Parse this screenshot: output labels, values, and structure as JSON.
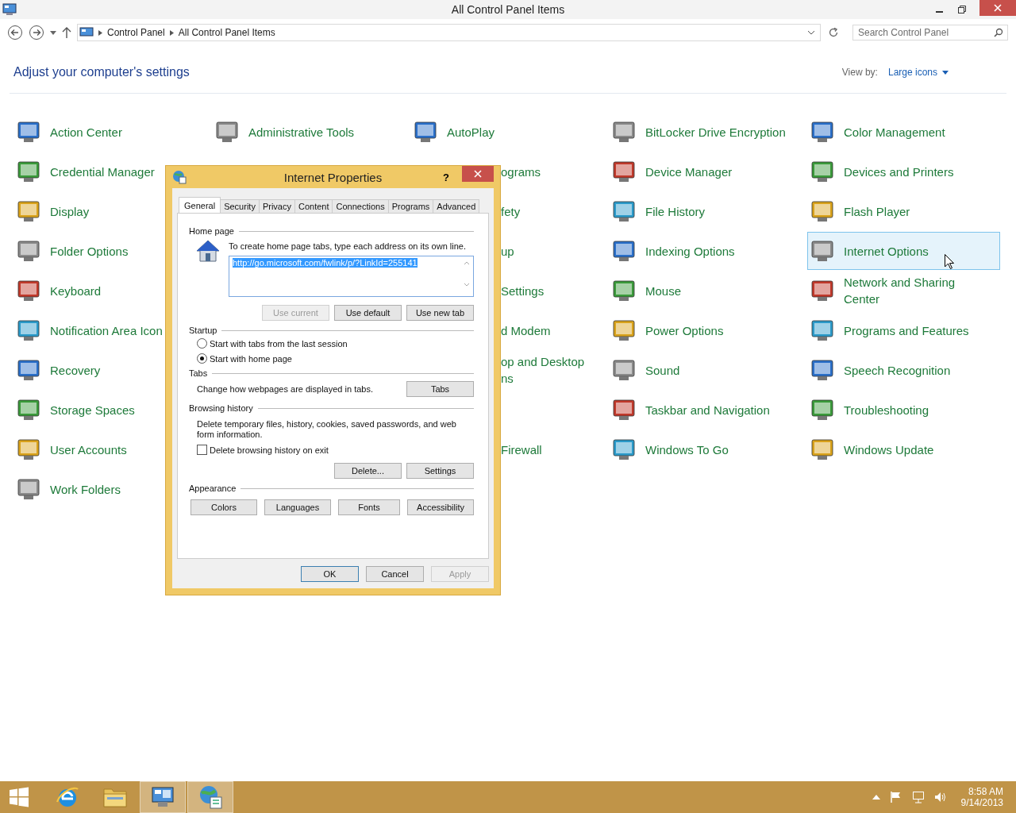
{
  "window": {
    "title": "All Control Panel Items",
    "breadcrumbs": [
      "Control Panel",
      "All Control Panel Items"
    ],
    "search": {
      "placeholder": "Search Control Panel"
    }
  },
  "header": {
    "heading": "Adjust your computer's settings",
    "view_by_label": "View by:",
    "view_by_value": "Large icons"
  },
  "columns": [
    {
      "items": [
        {
          "kind": "full",
          "label": "Action Center",
          "selected": false
        },
        {
          "kind": "full",
          "label": "Credential Manager",
          "selected": false
        },
        {
          "kind": "full",
          "label": "Display",
          "selected": false
        },
        {
          "kind": "full",
          "label": "Folder Options",
          "selected": false
        },
        {
          "kind": "full",
          "label": "Keyboard",
          "selected": false
        },
        {
          "kind": "full",
          "label": "Notification Area Icon",
          "selected": false
        },
        {
          "kind": "full",
          "label": "Recovery",
          "selected": false
        },
        {
          "kind": "full",
          "label": "Storage Spaces",
          "selected": false
        },
        {
          "kind": "full",
          "label": "User Accounts",
          "selected": false
        },
        {
          "kind": "full",
          "label": "Work Folders",
          "selected": false
        }
      ]
    },
    {
      "items": [
        {
          "kind": "full",
          "label": "Administrative Tools",
          "selected": false
        }
      ]
    },
    {
      "items": [
        {
          "kind": "full",
          "label": "AutoPlay",
          "selected": false
        },
        {
          "kind": "clipped",
          "label": "ograms",
          "selected": false
        },
        {
          "kind": "clipped",
          "label": "fety",
          "selected": false
        },
        {
          "kind": "clipped",
          "label": "up",
          "selected": false
        },
        {
          "kind": "clipped",
          "label": "Settings",
          "selected": false
        },
        {
          "kind": "clipped",
          "label": "d Modem",
          "selected": false
        },
        {
          "kind": "clipped",
          "label": "op and Desktop ns",
          "selected": false
        },
        {
          "kind": "covered"
        },
        {
          "kind": "clipped",
          "label": "Firewall",
          "selected": false
        }
      ]
    },
    {
      "items": [
        {
          "kind": "full",
          "label": "BitLocker Drive Encryption",
          "selected": false
        },
        {
          "kind": "full",
          "label": "Device Manager",
          "selected": false
        },
        {
          "kind": "full",
          "label": "File History",
          "selected": false
        },
        {
          "kind": "full",
          "label": "Indexing Options",
          "selected": false
        },
        {
          "kind": "full",
          "label": "Mouse",
          "selected": false
        },
        {
          "kind": "full",
          "label": "Power Options",
          "selected": false
        },
        {
          "kind": "full",
          "label": "Sound",
          "selected": false
        },
        {
          "kind": "full",
          "label": "Taskbar and Navigation",
          "selected": false
        },
        {
          "kind": "full",
          "label": "Windows To Go",
          "selected": false
        }
      ]
    },
    {
      "items": [
        {
          "kind": "full",
          "label": "Color Management",
          "selected": false
        },
        {
          "kind": "full",
          "label": "Devices and Printers",
          "selected": false
        },
        {
          "kind": "full",
          "label": "Flash Player",
          "selected": false
        },
        {
          "kind": "full",
          "label": "Internet Options",
          "selected": true
        },
        {
          "kind": "full",
          "label": "Network and Sharing Center",
          "selected": false
        },
        {
          "kind": "full",
          "label": "Programs and Features",
          "selected": false
        },
        {
          "kind": "full",
          "label": "Speech Recognition",
          "selected": false
        },
        {
          "kind": "full",
          "label": "Troubleshooting",
          "selected": false
        },
        {
          "kind": "full",
          "label": "Windows Update",
          "selected": false
        }
      ]
    }
  ],
  "dialog": {
    "title": "Internet Properties",
    "help": "?",
    "tabs": [
      {
        "label": "General",
        "selected": true
      },
      {
        "label": "Security",
        "selected": false
      },
      {
        "label": "Privacy",
        "selected": false
      },
      {
        "label": "Content",
        "selected": false
      },
      {
        "label": "Connections",
        "selected": false
      },
      {
        "label": "Programs",
        "selected": false
      },
      {
        "label": "Advanced",
        "selected": false
      }
    ],
    "home_page": {
      "heading": "Home page",
      "instruction": "To create home page tabs, type each address on its own line.",
      "value": "http://go.microsoft.com/fwlink/p/?LinkId=255141",
      "buttons": [
        {
          "label": "Use current",
          "disabled": true
        },
        {
          "label": "Use default",
          "disabled": false
        },
        {
          "label": "Use new tab",
          "disabled": false
        }
      ]
    },
    "startup": {
      "heading": "Startup",
      "options": [
        {
          "label": "Start with tabs from the last session",
          "selected": false
        },
        {
          "label": "Start with home page",
          "selected": true
        }
      ]
    },
    "tabs_section": {
      "heading": "Tabs",
      "description": "Change how webpages are displayed in tabs.",
      "button": "Tabs"
    },
    "browsing_history": {
      "heading": "Browsing history",
      "description": "Delete temporary files, history, cookies, saved passwords, and web form information.",
      "checkbox": {
        "label": "Delete browsing history on exit",
        "checked": false
      },
      "buttons": [
        "Delete...",
        "Settings"
      ]
    },
    "appearance": {
      "heading": "Appearance",
      "buttons": [
        "Colors",
        "Languages",
        "Fonts",
        "Accessibility"
      ]
    },
    "footer_buttons": [
      {
        "label": "OK",
        "disabled": false,
        "default": true
      },
      {
        "label": "Cancel",
        "disabled": false,
        "default": false
      },
      {
        "label": "Apply",
        "disabled": true,
        "default": false
      }
    ]
  },
  "taskbar": {
    "apps": [
      {
        "kind": "browser",
        "open": false
      },
      {
        "kind": "folder",
        "open": false
      },
      {
        "kind": "control-panel",
        "open": true
      },
      {
        "kind": "internet-options",
        "open": true
      }
    ],
    "time": "8:58 AM",
    "date": "9/14/2013"
  }
}
